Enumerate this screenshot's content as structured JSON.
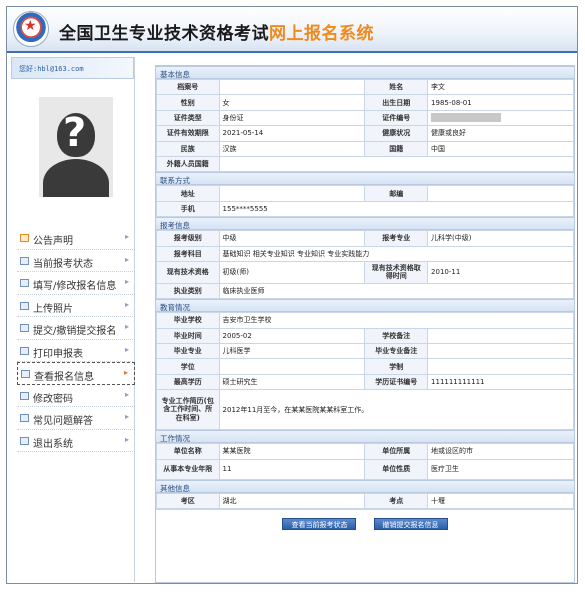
{
  "header": {
    "title_main": "全国卫生专业技术资格考试",
    "title_accent": "网上报名系统"
  },
  "sidebar": {
    "welcome": "您好:hbl@163.com",
    "photo_symbol": "?",
    "nav": [
      {
        "label": "公告声明"
      },
      {
        "label": "当前报考状态"
      },
      {
        "label": "填写/修改报名信息"
      },
      {
        "label": "上传照片"
      },
      {
        "label": "提交/撤销提交报名"
      },
      {
        "label": "打印申报表"
      },
      {
        "label": "查看报名信息"
      },
      {
        "label": "修改密码"
      },
      {
        "label": "常见问题解答"
      },
      {
        "label": "退出系统"
      }
    ]
  },
  "basic": {
    "heading": "基本信息",
    "labels": {
      "file_no": "档案号",
      "name": "姓名",
      "gender": "性别",
      "birth": "出生日期",
      "id_type": "证件类型",
      "id_no": "证件编号",
      "id_valid": "证件有效期限",
      "health": "健康状况",
      "ethnic": "民族",
      "nation": "国籍",
      "foreign_nation": "外籍人员国籍"
    },
    "values": {
      "file_no": "",
      "name": "李文",
      "gender": "女",
      "birth": "1985-08-01",
      "id_type": "身份证",
      "id_no": "",
      "id_valid": "2021-05-14",
      "health": "健康或良好",
      "ethnic": "汉族",
      "nation": "中国",
      "foreign_nation": ""
    }
  },
  "contact": {
    "heading": "联系方式",
    "labels": {
      "address": "地址",
      "zip": "邮编",
      "phone": "手机"
    },
    "values": {
      "address": "",
      "zip": "",
      "phone": "155****5555"
    }
  },
  "exam": {
    "heading": "报考信息",
    "labels": {
      "level": "报考级别",
      "major": "报考专业",
      "subjects": "报考科目",
      "cur_title": "现有技术资格",
      "cur_title_date": "现有技术资格取得时间",
      "practice_type": "执业类别"
    },
    "values": {
      "level": "中级",
      "major": "儿科学(中级)",
      "subjects": "基础知识 相关专业知识 专业知识 专业实践能力",
      "cur_title": "初级(师)",
      "cur_title_date": "2010-11",
      "practice_type": "临床执业医师"
    }
  },
  "education": {
    "heading": "教育情况",
    "labels": {
      "school": "毕业学校",
      "grad_time": "毕业时间",
      "school_note": "学校备注",
      "grad_major": "毕业专业",
      "major_note": "毕业专业备注",
      "degree": "学位",
      "edu_system": "学制",
      "highest_edu": "最高学历",
      "edu_cert_no": "学历证书编号",
      "work_history": "专业工作简历(包含工作时间、所在科室)"
    },
    "values": {
      "school": "吉安市卫生学校",
      "grad_time": "2005-02",
      "school_note": "",
      "grad_major": "儿科医学",
      "major_note": "",
      "degree": "",
      "edu_system": "",
      "highest_edu": "硕士研究生",
      "edu_cert_no": "111111111111",
      "work_history": "2012年11月至今，在某某医院某某科室工作。"
    }
  },
  "work": {
    "heading": "工作情况",
    "labels": {
      "unit": "单位名称",
      "unit_region": "单位所属",
      "years": "从事本专业年限",
      "unit_nature": "单位性质"
    },
    "values": {
      "unit": "某某医院",
      "unit_region": "地或设区的市",
      "years": "11",
      "unit_nature": "医疗卫生"
    }
  },
  "other": {
    "heading": "其他信息",
    "labels": {
      "exam_area": "考区",
      "exam_site": "考点"
    },
    "values": {
      "exam_area": "湖北",
      "exam_site": "十堰"
    }
  },
  "buttons": {
    "view_status": "查看当前报考状态",
    "cancel_submit": "撤销提交报名信息"
  }
}
